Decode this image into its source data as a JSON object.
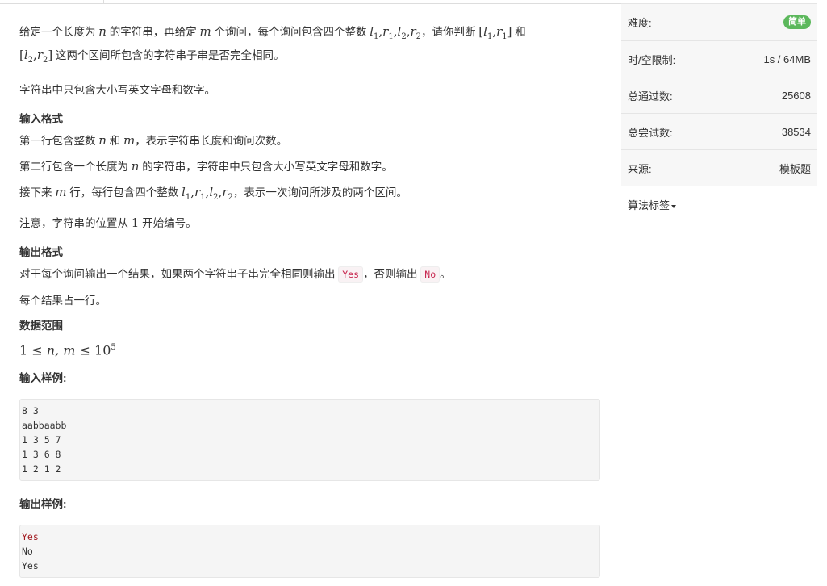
{
  "problem": {
    "desc1": {
      "t1": "给定一个长度为 ",
      "m_n": "n",
      "t2": " 的字符串，再给定 ",
      "m_m": "m",
      "t3": " 个询问，每个询问包含四个整数 ",
      "l": "l",
      "r": "r",
      "s1": "1",
      "s2": "2",
      "comma": ",",
      "t4": "，请你判断 ",
      "lb": "[",
      "rb": "]",
      "t5": " 和",
      "t6": " 这两个区间所包含的字符串子串是否完全相同。"
    },
    "desc2": "字符串中只包含大小写英文字母和数字。",
    "input_title": "输入格式",
    "input1": {
      "t1": "第一行包含整数 ",
      "t2": " 和 ",
      "t3": "，表示字符串长度和询问次数。"
    },
    "input2": {
      "t1": "第二行包含一个长度为 ",
      "t2": " 的字符串，字符串中只包含大小写英文字母和数字。"
    },
    "input3": {
      "t1": "接下来 ",
      "t2": " 行，每行包含四个整数 ",
      "t3": "，表示一次询问所涉及的两个区间。"
    },
    "note": {
      "t1": "注意，字符串的位置从 ",
      "num": "1",
      "t2": " 开始编号。"
    },
    "output_title": "输出格式",
    "output1": {
      "t1": "对于每个询问输出一个结果，如果两个字符串子串完全相同则输出 ",
      "yes": "Yes",
      "t2": "，否则输出 ",
      "no": "No",
      "t3": "。"
    },
    "output2": "每个结果占一行。",
    "range_title": "数据范围",
    "range": {
      "one": "1",
      "le": "≤",
      "vars": "n, m",
      "base": "10",
      "exp": "5"
    },
    "sample_input_title": "输入样例:",
    "sample_input": [
      "8 3",
      "aabbaabb",
      "1 3 5 7",
      "1 3 6 8",
      "1 2 1 2"
    ],
    "sample_output_title": "输出样例:",
    "sample_output": [
      "Yes",
      "No",
      "Yes"
    ]
  },
  "sidebar": {
    "difficulty_label": "难度:",
    "difficulty_value": "简单",
    "limit_label": "时/空限制:",
    "limit_value": "1s / 64MB",
    "passed_label": "总通过数:",
    "passed_value": "25608",
    "tried_label": "总尝试数:",
    "tried_value": "38534",
    "source_label": "来源:",
    "source_value": "模板题",
    "tags_label": "算法标签",
    "difficulty_color": "#5cb85c"
  }
}
